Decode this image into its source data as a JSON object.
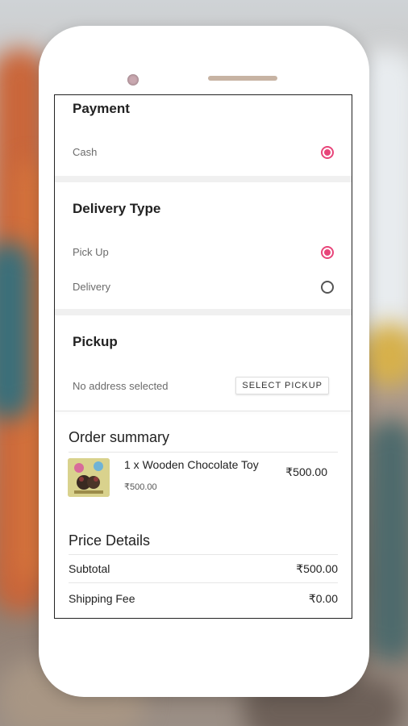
{
  "payment": {
    "title": "Payment",
    "options": [
      {
        "label": "Cash",
        "selected": true
      }
    ]
  },
  "delivery_type": {
    "title": "Delivery Type",
    "options": [
      {
        "label": "Pick Up",
        "selected": true
      },
      {
        "label": "Delivery",
        "selected": false
      }
    ]
  },
  "pickup": {
    "title": "Pickup",
    "address_status": "No address selected",
    "select_button": "SELECT PICKUP"
  },
  "order_summary": {
    "title": "Order summary",
    "items": [
      {
        "name": "1 x Wooden Chocolate Toy",
        "unit_price": "₹500.00",
        "total": "₹500.00"
      }
    ]
  },
  "price_details": {
    "title": "Price Details",
    "rows": [
      {
        "label": "Subtotal",
        "value": "₹500.00"
      },
      {
        "label": "Shipping Fee",
        "value": "₹0.00"
      }
    ]
  },
  "colors": {
    "accent": "#e8457a"
  }
}
